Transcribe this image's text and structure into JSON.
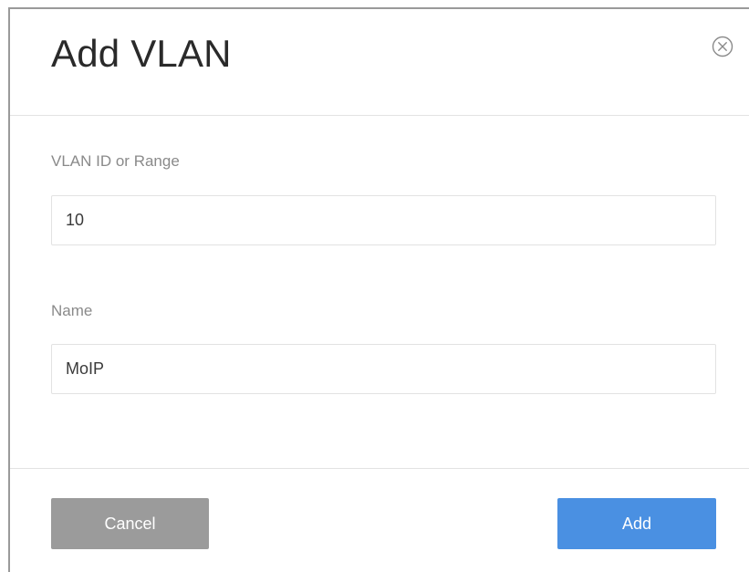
{
  "dialog": {
    "title": "Add VLAN",
    "close_icon": "close-circle-icon"
  },
  "fields": {
    "vlan_id": {
      "label": "VLAN ID or Range",
      "value": "10"
    },
    "name": {
      "label": "Name",
      "value": "MoIP"
    }
  },
  "footer": {
    "cancel_label": "Cancel",
    "add_label": "Add"
  },
  "colors": {
    "primary_button": "#4a90e2",
    "secondary_button": "#9b9b9b",
    "label_text": "#8a8a8a",
    "title_text": "#2a2a2a"
  }
}
